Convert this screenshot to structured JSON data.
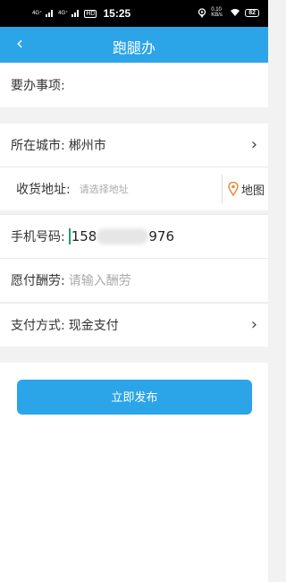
{
  "status_bar": {
    "signal1": "4G⁺",
    "signal2": "4G⁺",
    "hd": "HD",
    "time": "15:25",
    "speed": "0.10 KB/s",
    "battery": "82"
  },
  "header": {
    "title": "跑腿办",
    "back_icon": "chevron-left-icon"
  },
  "form": {
    "task_label": "要办事项:",
    "city_label": "所在城市:",
    "city_value": "郴州市",
    "address_label": "收货地址:",
    "address_placeholder": "请选择地址",
    "map_label": "地图",
    "phone_label": "手机号码:",
    "phone_prefix": "158",
    "phone_suffix": "976",
    "reward_label": "愿付酬劳:",
    "reward_placeholder": "请输入酬劳",
    "payment_label": "支付方式:",
    "payment_value": "现金支付"
  },
  "submit_label": "立即发布",
  "colors": {
    "accent": "#2ba4e8",
    "pin": "#f0883a"
  }
}
